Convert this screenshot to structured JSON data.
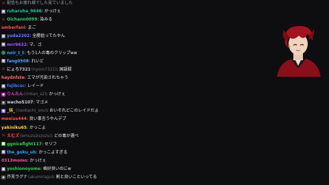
{
  "chat": {
    "messages": [
      {
        "badge": "sword",
        "user": "",
        "alt": "",
        "text": "配信もお疲れ様でした見ていました",
        "color": "#9aa0a8"
      },
      {
        "badge": "bot",
        "user": "ruharuha_9646",
        "alt": "",
        "text": ": かっけぇ",
        "color": "#1fc8a0"
      },
      {
        "badge": "sword",
        "user": "Oichann0099",
        "alt": "",
        "text": ": 染みる",
        "color": "#2ecc71"
      },
      {
        "badge": "",
        "user": "amberfani",
        "alt": "",
        "text": ": まご",
        "color": "#ff4d4d"
      },
      {
        "badge": "bot",
        "user": "yuda2202",
        "alt": "",
        "text": ": 全勝狙ってたやん",
        "color": "#6a7bff"
      },
      {
        "badge": "bot",
        "user": "mrr9632",
        "alt": "",
        "text": ": マ、ゴ",
        "color": "#9b59ff"
      },
      {
        "badge": "dot",
        "user": "noir_t_t",
        "alt": "",
        "text": ": もう1人の毒のクリップww",
        "color": "#3aa0ff"
      },
      {
        "badge": "bot",
        "user": "fang0508",
        "alt": "",
        "text": ": れいど",
        "color": "#4aa3ff"
      },
      {
        "badge": "sword",
        "user": "にょろ7321",
        "alt": "(nyoro7321)",
        "text": ": 国語録",
        "color": "#c0c0c8"
      },
      {
        "badge": "",
        "user": "haydnfste",
        "alt": "",
        "text": ": エマが汚染されちゃう",
        "color": "#ff6a6a"
      },
      {
        "badge": "bot",
        "user": "fujibcsc",
        "alt": "",
        "text": ": レイード",
        "color": "#3a7bff"
      },
      {
        "badge": "vip",
        "user": "りんたん",
        "alt": "(rintan_s2)",
        "text": ": かっけぇ",
        "color": "#d050d0"
      },
      {
        "badge": "gray",
        "user": "wacho5107",
        "alt": "",
        "text": ": マゴメ",
        "color": "#d0d0d8"
      },
      {
        "badge": "sub",
        "user": "_抹_",
        "alt": "(naokachi_sou)",
        "text": ": おいそれどこのレイドだよ",
        "color": "#e8c040"
      },
      {
        "badge": "",
        "user": "meeius444",
        "alt": "",
        "text": ": 良い事言うやんデブ",
        "color": "#ff5050"
      },
      {
        "badge": "",
        "user": "yakiniku65",
        "alt": "",
        "text": ": かっこよ",
        "color": "#ffd24a"
      },
      {
        "badge": "sword",
        "user": "えむズ",
        "alt": "(emuzuzuzuzu)",
        "text": ": どの毒か選べ",
        "color": "#ff5050"
      },
      {
        "badge": "mod",
        "user": "ggnicefight117",
        "alt": "",
        "text": ": セリフ",
        "color": "#34d058"
      },
      {
        "badge": "bot",
        "user": "the_goku_uh",
        "alt": "",
        "text": ": かっこよすぎる",
        "color": "#3aa0ff"
      },
      {
        "badge": "",
        "user": "0313momo",
        "alt": "",
        "text": ": かっけぇ",
        "color": "#ff4d9d"
      },
      {
        "badge": "bot",
        "user": "yoshionoyome",
        "alt": "",
        "text": ": 格好良いのにw",
        "color": "#34d058"
      },
      {
        "badge": "gray",
        "user": "芥見ラグナ",
        "alt": "(akumiragu)",
        "text": ": 割と良いこといってる",
        "color": "#a0a0a8"
      }
    ]
  },
  "streamer": {
    "avatar_icon": "vtuber-avatar-icon"
  }
}
